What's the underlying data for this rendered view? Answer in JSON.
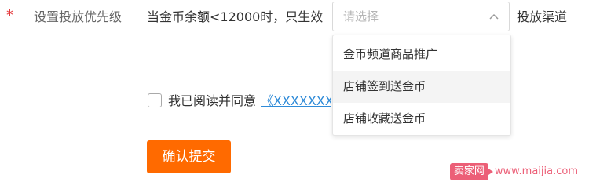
{
  "form": {
    "required_mark": "*",
    "priority_label": "设置投放优先级",
    "condition_text": "当金币余额<12000时，只生效",
    "select_placeholder": "请选择",
    "after_select_text": "投放渠道",
    "dropdown_options": [
      "金币频道商品推广",
      "店铺签到送金币",
      "店铺收藏送金币"
    ],
    "highlighted_option_index": 1,
    "agree_text": "我已阅读并同意",
    "agreement_link": "《XXXXXXX",
    "checkbox_checked": false,
    "confirm_button": "确认提交"
  },
  "watermark": {
    "brand": "卖家网",
    "url": "www.maijia.com"
  },
  "colors": {
    "required_star": "#e4393c",
    "link": "#2f8bd8",
    "button": "#ff6a00",
    "watermark": "#ea4e69"
  },
  "icons": {
    "select_chevron": "chevron-up-icon"
  }
}
